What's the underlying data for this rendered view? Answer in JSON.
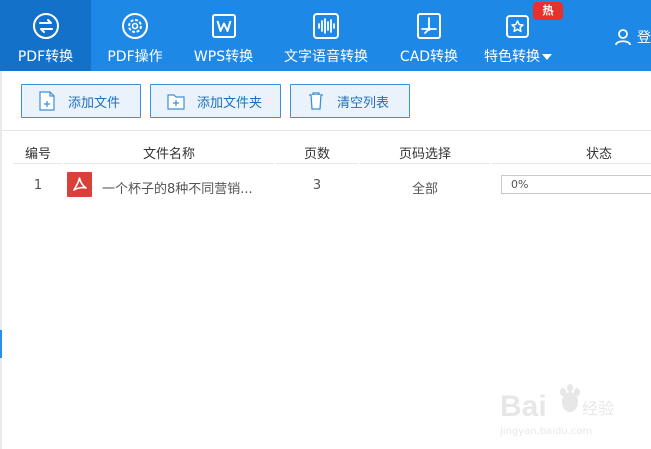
{
  "nav": {
    "items": [
      {
        "label": "PDF转换",
        "icon": "swap-arrows-icon"
      },
      {
        "label": "PDF操作",
        "icon": "gear-icon"
      },
      {
        "label": "WPS转换",
        "icon": "word-document-icon"
      },
      {
        "label": "文字语音转换",
        "icon": "audio-wave-icon"
      },
      {
        "label": "CAD转换",
        "icon": "cad-drawing-icon"
      },
      {
        "label": "特色转换",
        "icon": "star-box-icon"
      }
    ],
    "hot_badge": "热",
    "login": "登"
  },
  "toolbar": {
    "add_file": "添加文件",
    "add_folder": "添加文件夹",
    "clear_list": "清空列表"
  },
  "table": {
    "columns": [
      "编号",
      "文件名称",
      "页数",
      "页码选择",
      "状态"
    ],
    "rows": [
      {
        "index": "1",
        "name": "一个杯子的8种不同营销...",
        "pages": "3",
        "page_selection": "全部",
        "status": "0%",
        "progress": 0
      }
    ]
  },
  "watermark": {
    "brand": "Bai",
    "site": "jingyan.baidu.com",
    "product": "经验"
  },
  "colors": {
    "nav_bg": "#1e88e6",
    "nav_active": "#1471c9",
    "badge": "#e8312a",
    "button_border": "#3c8fd8",
    "pdf_red": "#d9403a"
  }
}
